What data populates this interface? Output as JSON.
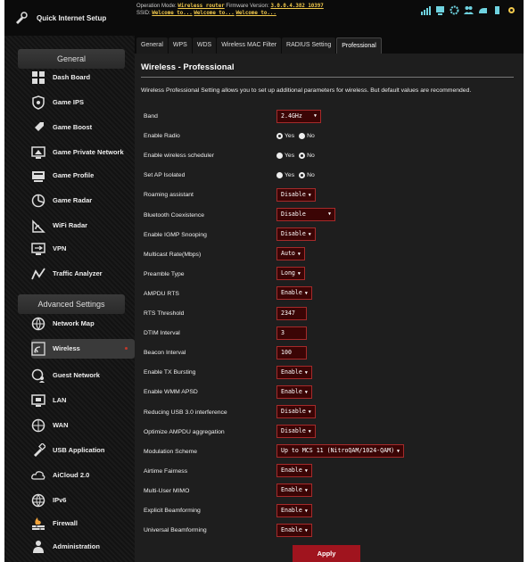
{
  "sidebar": {
    "quick_setup": "Quick Internet Setup",
    "general_title": "General",
    "general_items": [
      "Dash Board",
      "Game IPS",
      "Game Boost",
      "Game Private Network",
      "Game Profile",
      "Game Radar",
      "WiFi Radar",
      "VPN",
      "Traffic Analyzer"
    ],
    "advanced_title": "Advanced Settings",
    "advanced_items": [
      "Network Map",
      "Wireless",
      "Guest Network",
      "LAN",
      "WAN",
      "USB Application",
      "AiCloud 2.0",
      "IPv6",
      "Firewall",
      "Administration"
    ],
    "active_item": "Wireless"
  },
  "header": {
    "op_mode_label": "Operation Mode:",
    "op_mode_value": "Wireless router",
    "fw_label": "Firmware Version:",
    "fw_value": "3.0.0.4.382_10397",
    "ssid_label": "SSID:",
    "ssid_values": [
      "Welcome to...",
      "Welcome to...",
      "Welcome to..."
    ]
  },
  "tabs": [
    "General",
    "WPS",
    "WDS",
    "Wireless MAC Filter",
    "RADIUS Setting",
    "Professional"
  ],
  "selected_tab": "Professional",
  "page": {
    "title": "Wireless - Professional",
    "description": "Wireless Professional Setting allows you to set up additional parameters for wireless. But default values are recommended.",
    "apply_label": "Apply"
  },
  "settings": [
    {
      "label": "Band",
      "type": "select",
      "value": "2.4GHz"
    },
    {
      "label": "Enable Radio",
      "type": "radio",
      "options": [
        "Yes",
        "No"
      ],
      "selected": "Yes"
    },
    {
      "label": "Enable wireless scheduler",
      "type": "radio",
      "options": [
        "Yes",
        "No"
      ],
      "selected": "No"
    },
    {
      "label": "Set AP Isolated",
      "type": "radio",
      "options": [
        "Yes",
        "No"
      ],
      "selected": "No"
    },
    {
      "label": "Roaming assistant",
      "type": "select",
      "value": "Disable"
    },
    {
      "label": "Bluetooth Coexistence",
      "type": "select",
      "value": "Disable"
    },
    {
      "label": "Enable IGMP Snooping",
      "type": "select",
      "value": "Disable"
    },
    {
      "label": "Multicast Rate(Mbps)",
      "type": "select",
      "value": "Auto"
    },
    {
      "label": "Preamble Type",
      "type": "select",
      "value": "Long"
    },
    {
      "label": "AMPDU RTS",
      "type": "select",
      "value": "Enable"
    },
    {
      "label": "RTS Threshold",
      "type": "input",
      "value": "2347"
    },
    {
      "label": "DTIM Interval",
      "type": "input",
      "value": "3"
    },
    {
      "label": "Beacon Interval",
      "type": "input",
      "value": "100"
    },
    {
      "label": "Enable TX Bursting",
      "type": "select",
      "value": "Enable"
    },
    {
      "label": "Enable WMM APSD",
      "type": "select",
      "value": "Enable"
    },
    {
      "label": "Reducing USB 3.0 interference",
      "type": "select",
      "value": "Disable"
    },
    {
      "label": "Optimize AMPDU aggregation",
      "type": "select",
      "value": "Disable"
    },
    {
      "label": "Modulation Scheme",
      "type": "select",
      "value": "Up to MCS 11 (NitroQAM/1024-QAM)"
    },
    {
      "label": "Airtime Fairness",
      "type": "select",
      "value": "Enable"
    },
    {
      "label": "Multi-User MIMO",
      "type": "select",
      "value": "Enable"
    },
    {
      "label": "Explicit Beamforming",
      "type": "select",
      "value": "Enable"
    },
    {
      "label": "Universal Beamforming",
      "type": "select",
      "value": "Enable"
    }
  ],
  "colors": {
    "accent": "#a0141e",
    "field_bg": "#3b0505",
    "highlight": "#f2c94c"
  },
  "icons": [
    "quick-setup-icon",
    "dashboard-icon",
    "game-ips-icon",
    "game-boost-icon",
    "game-private-network-icon",
    "game-profile-icon",
    "game-radar-icon",
    "wifi-radar-icon",
    "vpn-icon",
    "traffic-analyzer-icon",
    "network-map-icon",
    "wireless-icon",
    "guest-network-icon",
    "lan-icon",
    "wan-icon",
    "usb-application-icon",
    "aicloud-icon",
    "ipv6-icon",
    "firewall-icon",
    "administration-icon"
  ]
}
